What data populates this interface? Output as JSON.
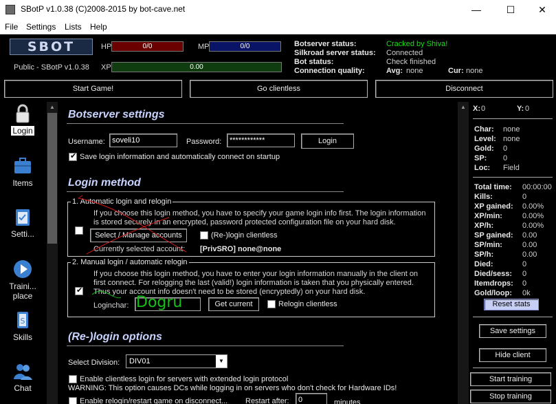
{
  "window": {
    "title": "SBotP v1.0.38 (C)2008-2015 by bot-cave.net"
  },
  "menu": [
    "File",
    "Settings",
    "Lists",
    "Help"
  ],
  "top": {
    "logo": "SBOT",
    "version": "Public - SBotP v1.0.38",
    "hp_label": "HP",
    "hp_value": "0/0",
    "mp_label": "MP",
    "mp_value": "0/0",
    "xp_label": "XP",
    "xp_value": "0.00",
    "status": {
      "botserver_label": "Botserver status:",
      "botserver_value": "Cracked by Shiva!",
      "silkroad_label": "Silkroad server status:",
      "silkroad_value": "Connected",
      "bot_label": "Bot status:",
      "bot_value": "Check finished",
      "conn_label": "Connection quality:",
      "avg_label": "Avg:",
      "avg_value": "none",
      "cur_label": "Cur:",
      "cur_value": "none"
    },
    "buttons": {
      "start_game": "Start Game!",
      "go_clientless": "Go clientless",
      "disconnect": "Disconnect"
    }
  },
  "nav": [
    {
      "label": "Login",
      "icon": "lock-icon"
    },
    {
      "label": "Items",
      "icon": "briefcase-icon"
    },
    {
      "label": "Setti...",
      "icon": "clipboard-icon"
    },
    {
      "label": "Traini... place",
      "icon": "play-icon"
    },
    {
      "label": "Skills",
      "icon": "book-icon"
    },
    {
      "label": "Chat",
      "icon": "people-icon"
    }
  ],
  "content": {
    "botserver_title": "Botserver settings",
    "username_label": "Username:",
    "username_value": "soveli10",
    "password_label": "Password:",
    "password_value": "************",
    "login_btn": "Login",
    "save_login_label": "Save login information and automatically connect on startup",
    "login_method_title": "Login method",
    "auto_group_title": "1. Automatic login and relogin",
    "auto_desc_1": "If you choose this login method, you have to specify your game login info first. The login information",
    "auto_desc_2": "is stored securely in an encrypted, password protected configuration file on your hard disk.",
    "select_manage_btn": "Select / Manage accounts",
    "relogin_clientless_auto": "(Re-)login clientless",
    "current_account_label": "Currently selected account:",
    "current_account_value": "[PrivSRO] none@none",
    "manual_group_title": "2. Manual login / automatic relogin",
    "manual_desc_1": "If you choose this login method, you have to enter your login information manually in the client on",
    "manual_desc_2": "first connect. For relogging the last (valid!) login information is taken that you physically entered.",
    "manual_desc_3": "Thus your account info doesn't need to be stored (encryptedly) on your hard disk.",
    "loginchar_label": "Loginchar:",
    "loginchar_value": "Dogru",
    "get_current_btn": "Get current",
    "relogin_clientless_manual": "Relogin clientless",
    "relogin_options_title": "(Re-)login options",
    "division_label": "Select Division:",
    "division_value": "DIV01",
    "enable_clientless_label": "Enable clientless login for servers with extended login protocol",
    "warning_text": "WARNING: This option causes DCs while logging in on servers who don't check for Hardware IDs!",
    "enable_relogin_label": "Enable relogin/restart game on disconnect...",
    "restart_after_label": "Restart after:",
    "restart_after_value": "0",
    "minutes_label": "minutes"
  },
  "right": {
    "x_label": "X:",
    "x_value": "0",
    "y_label": "Y:",
    "y_value": "0",
    "char_label": "Char:",
    "char_value": "none",
    "level_label": "Level:",
    "level_value": "none",
    "gold_label": "Gold:",
    "gold_value": "0",
    "sp_label": "SP:",
    "sp_value": "0",
    "loc_label": "Loc:",
    "loc_value": "Field",
    "total_time_label": "Total time:",
    "total_time_value": "00:00:00",
    "kills_label": "Kills:",
    "kills_value": "0",
    "xp_gained_label": "XP gained:",
    "xp_gained_value": "0.00%",
    "xp_min_label": "XP/min:",
    "xp_min_value": "0.00%",
    "xp_h_label": "XP/h:",
    "xp_h_value": "0.00%",
    "sp_gained_label": "SP gained:",
    "sp_gained_value": "0.00",
    "sp_min_label": "SP/min:",
    "sp_min_value": "0.00",
    "sp_h_label": "SP/h:",
    "sp_h_value": "0.00",
    "died_label": "Died:",
    "died_value": "0",
    "died_sess_label": "Died/sess:",
    "died_sess_value": "0",
    "itemdrops_label": "Itemdrops:",
    "itemdrops_value": "0",
    "gold_loop_label": "Gold/loop:",
    "gold_loop_value": "0k",
    "reset_stats": "Reset stats",
    "save_settings": "Save settings",
    "hide_client": "Hide client",
    "start_training": "Start training",
    "stop_training": "Stop training"
  },
  "colors": {
    "hp": "#6b0000",
    "mp": "#0a1466",
    "xp": "#0f3d0f",
    "status_green": "#18e018",
    "section_title": "#c8d4ff",
    "annotation_green": "#16c016",
    "annotation_red": "#d01818"
  }
}
